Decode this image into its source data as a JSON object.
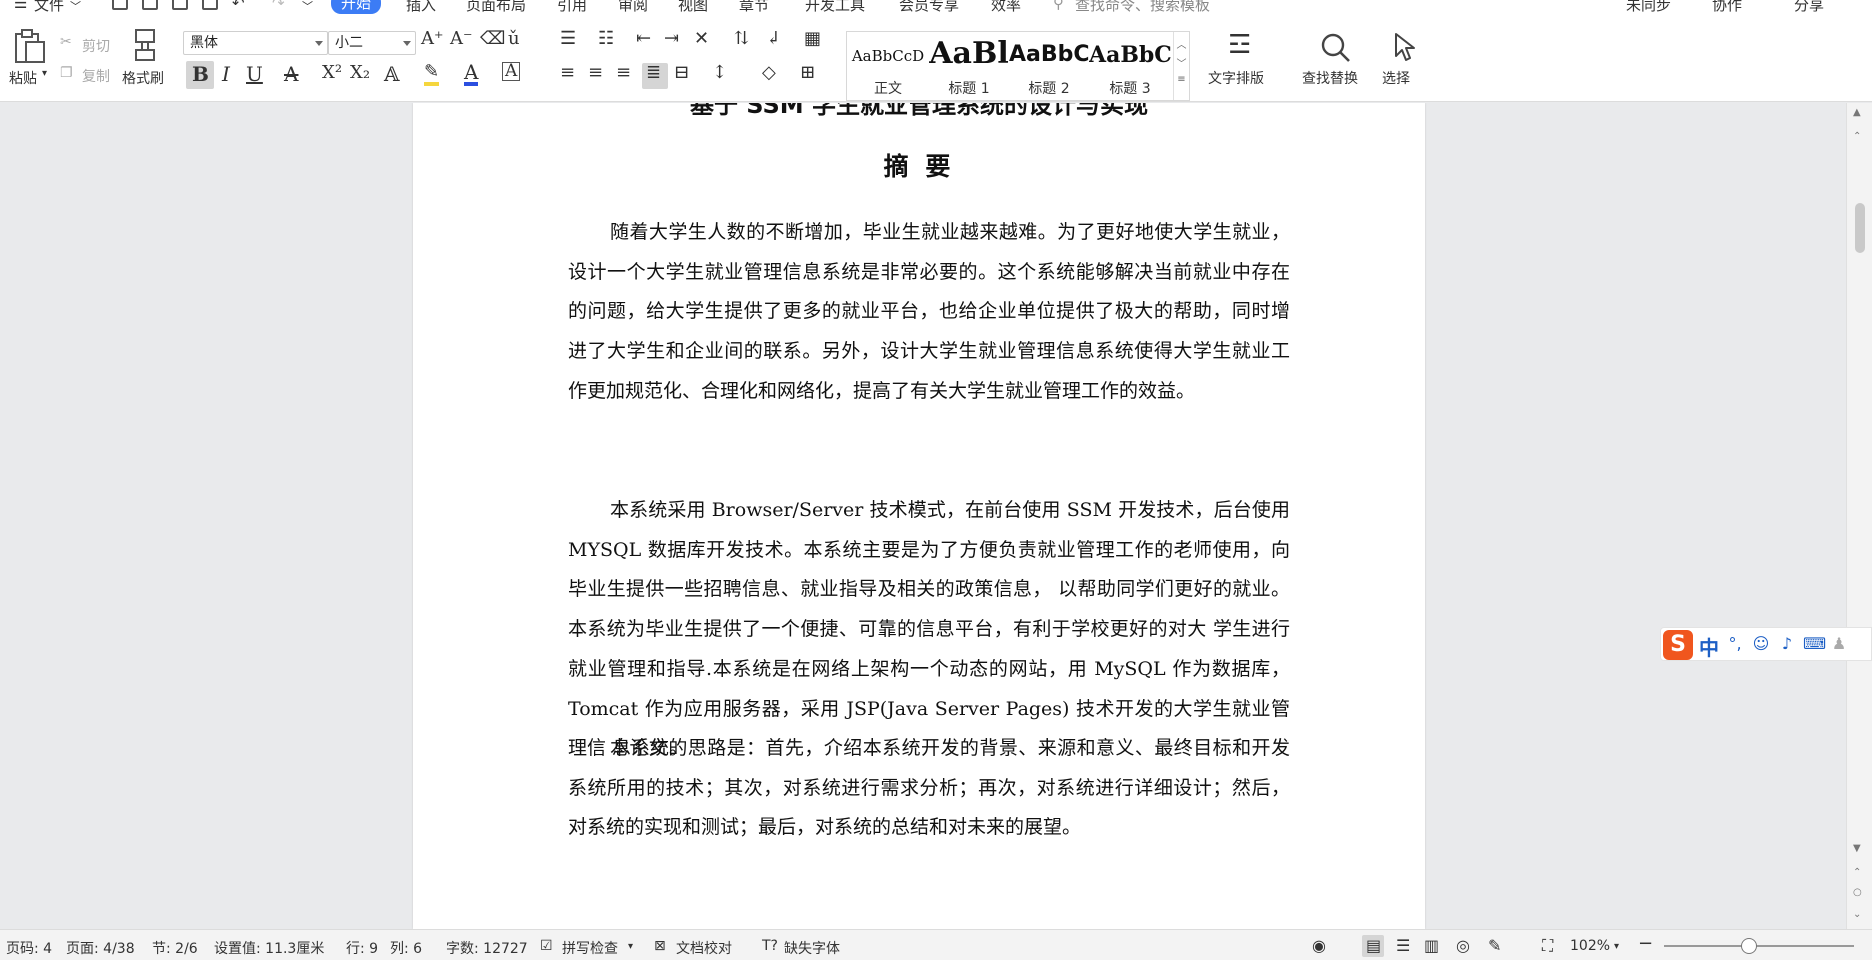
{
  "menubar": {
    "file": "文件",
    "tabs": [
      "开始",
      "插入",
      "页面布局",
      "引用",
      "审阅",
      "视图",
      "章节",
      "开发工具",
      "会员专享",
      "效率"
    ],
    "active_tab": "开始",
    "search_placeholder": "查找命令、搜索模板",
    "right": {
      "sync": "未同步",
      "collab": "协作",
      "share": "分享"
    }
  },
  "ribbon": {
    "paste": "粘贴",
    "cut": "剪切",
    "copy": "复制",
    "format_painter": "格式刷",
    "font_name": "黑体",
    "font_size": "小二",
    "styles": [
      {
        "sample": "AaBbCcD",
        "label": "正文"
      },
      {
        "sample": "AaBl",
        "label": "标题 1"
      },
      {
        "sample": "AaBbC",
        "label": "标题 2"
      },
      {
        "sample": "AaBbC",
        "label": "标题 3"
      }
    ],
    "text_layout": "文字排版",
    "find_replace": "查找替换",
    "select": "选择"
  },
  "document": {
    "title_partial": "基于 SSM 学生就业管理系统的设计与实现",
    "heading": "摘  要",
    "paragraphs": [
      "随着大学生人数的不断增加，毕业生就业越来越难。为了更好地使大学生就业， 设计一个大学生就业管理信息系统是非常必要的。这个系统能够解决当前就业中存在  的问题，给大学生提供了更多的就业平台，也给企业单位提供了极大的帮助，同时增  进了大学生和企业间的联系。另外，设计大学生就业管理信息系统使得大学生就业工  作更加规范化、合理化和网络化，提高了有关大学生就业管理工作的效益。",
      "本系统采用  Browser/Server  技术模式，在前台使用  SSM 开发技术，后台使用  MYSQL 数据库开发技术。本系统主要是为了方便负责就业管理工作的老师使用，向毕业生提供一些招聘信息、就业指导及相关的政策信息，  以帮助同学们更好的就业。  本系统为毕业生提供了一个便捷、可靠的信息平台，有利于学校更好的对大  学生进行就业管理和指导.本系统是在网络上架构一个动态的网站，用 MySQL  作为数据库，  Tomcat  作为应用服务器，采用  JSP(Java Server Pages)  技术开发的大学生就业管理信  息系统。",
      "本论文的思路是：首先，介绍本系统开发的背景、来源和意义、最终目标和开发  系统所用的技术；其次，对系统进行需求分析；再次，对系统进行详细设计；然后，  对系统的实现和测试；最后，对系统的总结和对未来的展望。"
    ]
  },
  "ime": {
    "mode": "中"
  },
  "status": {
    "page_code": "页码: 4",
    "page": "页面: 4/38",
    "section": "节: 2/6",
    "setting": "设置值: 11.3厘米",
    "row": "行: 9",
    "col": "列: 6",
    "words": "字数: 12727",
    "spellcheck": "拼写检查",
    "proofread": "文档校对",
    "missing_font": "缺失字体",
    "zoom": "102%"
  },
  "colors": {
    "accent": "#3c7cf5",
    "ime_orange": "#f0561e",
    "ime_blue": "#1d5fc5"
  }
}
